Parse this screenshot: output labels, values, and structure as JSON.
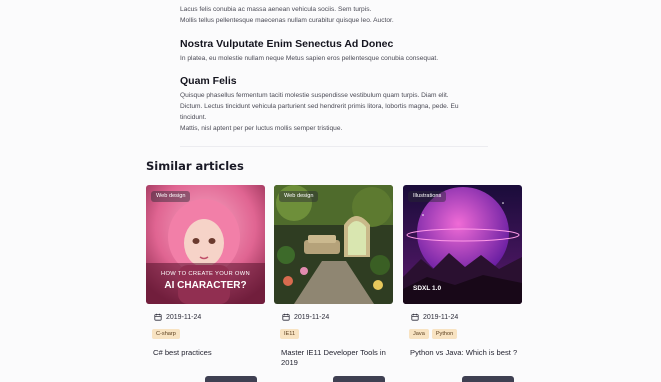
{
  "article": {
    "intro_lines": [
      "Lacus felis conubia ac massa aenean vehicula sociis. Sem turpis.",
      "Mollis tellus pellentesque maecenas nullam curabitur quisque leo. Auctor."
    ],
    "sections": [
      {
        "title": "Nostra Vulputate Enim Senectus Ad Donec",
        "lines": [
          "In platea, eu molestie nullam neque Metus sapien eros pellentesque conubia consequat."
        ]
      },
      {
        "title": "Quam Felis",
        "lines": [
          "Quisque phasellus fermentum taciti molestie suspendisse vestibulum quam turpis. Diam elit.",
          "Dictum. Lectus tincidunt vehicula parturient sed hendrerit primis litora, lobortis magna, pede. Eu",
          "tincidunt.",
          "Mattis, nisl aptent per per luctus mollis semper tristique."
        ]
      }
    ]
  },
  "similar": {
    "heading": "Similar articles",
    "cards": [
      {
        "category": "Web design",
        "overlay_small": "HOW TO CREATE YOUR OWN",
        "overlay_large": "AI CHARACTER?",
        "date": "2019-11-24",
        "tags": [
          "C-sharp"
        ],
        "title": "C# best practices"
      },
      {
        "category": "Web design",
        "date": "2019-11-24",
        "tags": [
          "IE11"
        ],
        "title": "Master IE11 Developer Tools in 2019"
      },
      {
        "category": "Illustrations",
        "overlay_large": "SDXL 1.0",
        "date": "2019-11-24",
        "tags": [
          "Java",
          "Python"
        ],
        "title": "Python vs Java: Which is best ?"
      }
    ]
  },
  "colors": {
    "tag_bg": "#f8e3c2",
    "button_dark": "#3f4052",
    "thumb_1": "#e56d9c",
    "thumb_2": "#5d7a3a",
    "thumb_3": "#9c2dbd"
  },
  "icons": [
    "calendar-icon"
  ]
}
